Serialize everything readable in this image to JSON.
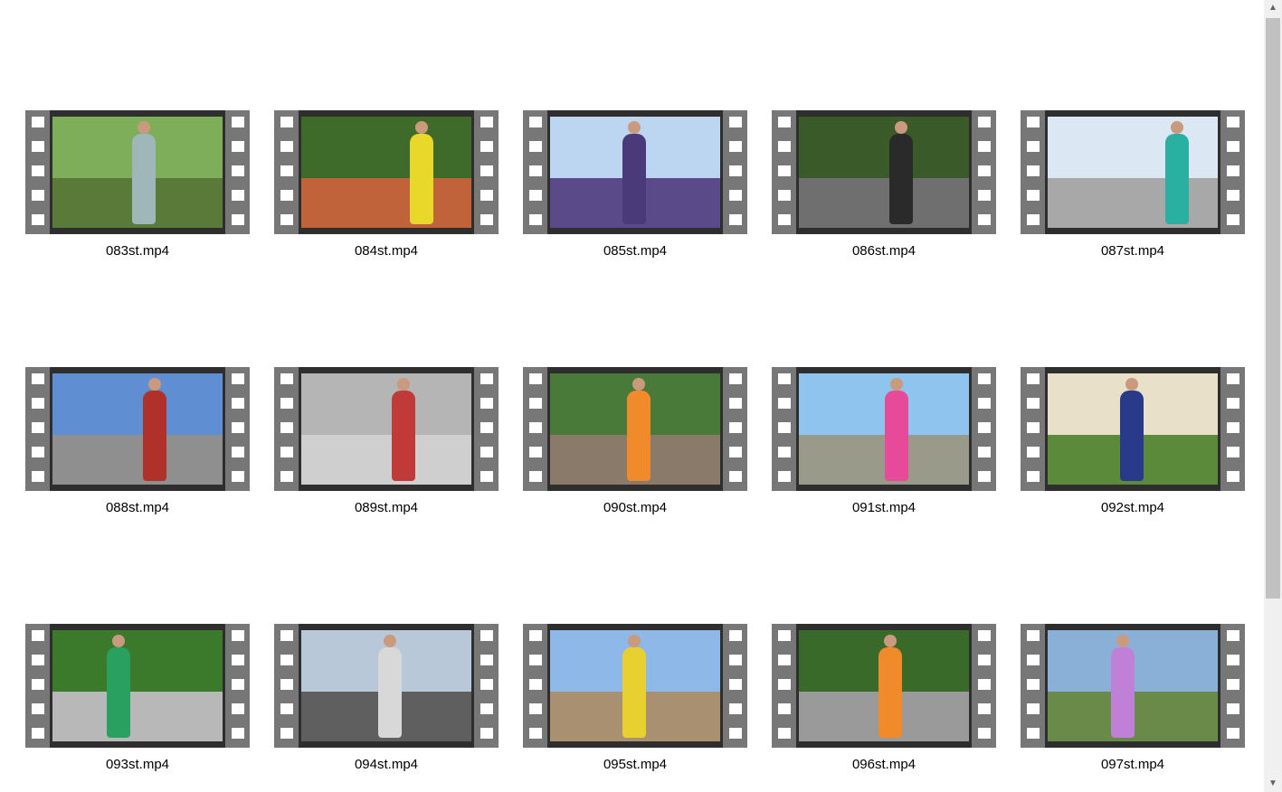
{
  "files": [
    {
      "name": "083st.mp4",
      "sky": "#7fae5a",
      "ground": "#5a7a3a",
      "outfit": "#9fb7b9",
      "fx": 88
    },
    {
      "name": "084st.mp4",
      "sky": "#3f6b2a",
      "ground": "#c0623a",
      "outfit": "#e8d82a",
      "fx": 120
    },
    {
      "name": "085st.mp4",
      "sky": "#bcd6f2",
      "ground": "#5b4a8a",
      "outfit": "#4a3a7a",
      "fx": 80
    },
    {
      "name": "086st.mp4",
      "sky": "#3a5a2a",
      "ground": "#6f6f6f",
      "outfit": "#2a2a2a",
      "fx": 100
    },
    {
      "name": "087st.mp4",
      "sky": "#dbe8f4",
      "ground": "#a8a8a8",
      "outfit": "#2ab0a0",
      "fx": 130
    },
    {
      "name": "088st.mp4",
      "sky": "#5f8fd2",
      "ground": "#8f8f8f",
      "outfit": "#b0302a",
      "fx": 100
    },
    {
      "name": "089st.mp4",
      "sky": "#b5b5b5",
      "ground": "#cfcfcf",
      "outfit": "#c03a3a",
      "fx": 100
    },
    {
      "name": "090st.mp4",
      "sky": "#4a7a3a",
      "ground": "#8a7a6a",
      "outfit": "#f08a2a",
      "fx": 85
    },
    {
      "name": "091st.mp4",
      "sky": "#8ec4ee",
      "ground": "#9a9a8a",
      "outfit": "#e84a9a",
      "fx": 95
    },
    {
      "name": "092st.mp4",
      "sky": "#e8e0c8",
      "ground": "#5a8a3a",
      "outfit": "#2a3a8a",
      "fx": 80
    },
    {
      "name": "093st.mp4",
      "sky": "#3a7a2a",
      "ground": "#b8b8b8",
      "outfit": "#2aa060",
      "fx": 60
    },
    {
      "name": "094st.mp4",
      "sky": "#b8c8d8",
      "ground": "#5f5f5f",
      "outfit": "#d8d8d8",
      "fx": 85
    },
    {
      "name": "095st.mp4",
      "sky": "#8eb8e8",
      "ground": "#a89070",
      "outfit": "#e8d030",
      "fx": 80
    },
    {
      "name": "096st.mp4",
      "sky": "#3a6a2a",
      "ground": "#9a9a9a",
      "outfit": "#f08a2a",
      "fx": 88
    },
    {
      "name": "097st.mp4",
      "sky": "#8ab0d8",
      "ground": "#6a8a4a",
      "outfit": "#c080d8",
      "fx": 70
    }
  ],
  "scrollbar": {
    "up_arrow": "▲",
    "down_arrow": "▼"
  }
}
